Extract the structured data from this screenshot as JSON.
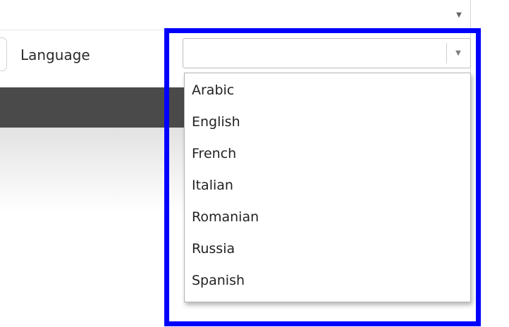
{
  "form": {
    "top_dropdown_icon": "chevron-down-icon",
    "language_label": "Language",
    "language_select": {
      "value": "",
      "arrow_icon": "chevron-down-icon",
      "options": [
        "Arabic",
        "English",
        "French",
        "Italian",
        "Romanian",
        "Russia",
        "Spanish"
      ]
    }
  },
  "annotation": {
    "highlight_color": "#0000ff"
  },
  "background": {
    "band_color": "#4a4a4a"
  }
}
